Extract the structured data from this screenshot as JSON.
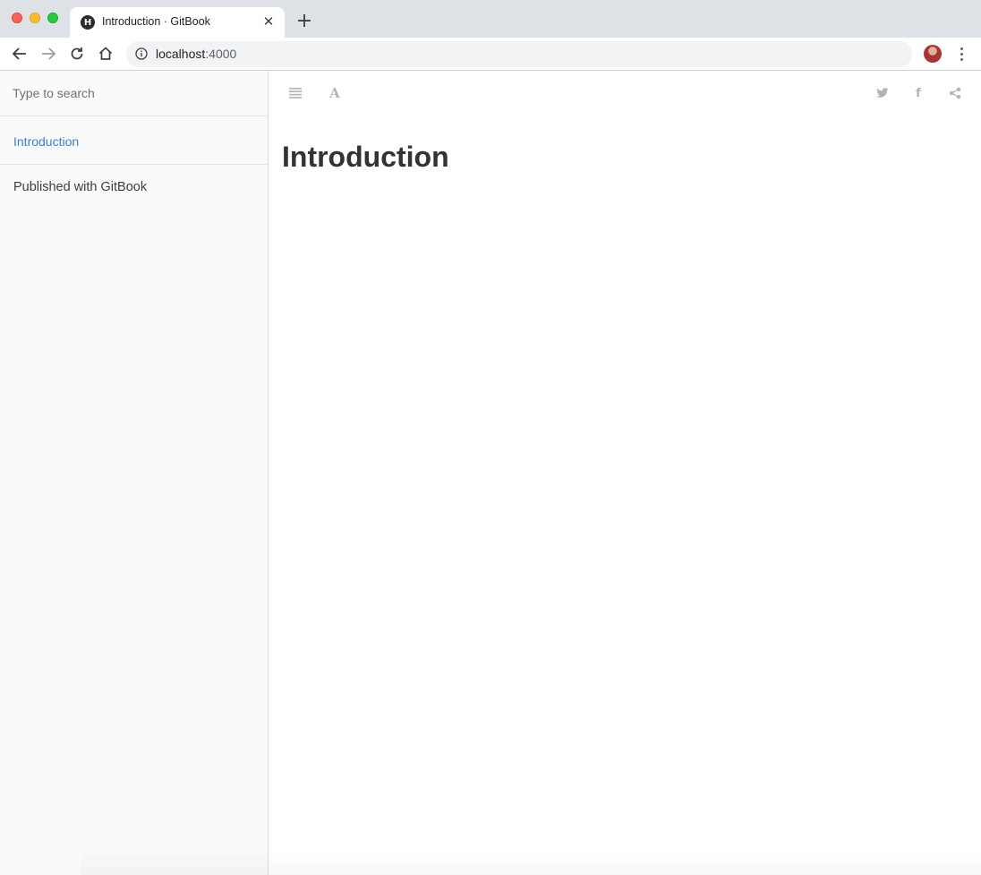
{
  "browser": {
    "tab": {
      "favicon_letter": "H",
      "title": "Introduction · GitBook",
      "close_symbol": "✕"
    },
    "new_tab_symbol": "+",
    "address": {
      "host": "localhost",
      "port": ":4000"
    },
    "icons": {
      "back": "back-arrow-icon",
      "forward": "forward-arrow-icon",
      "reload": "reload-icon",
      "home": "home-icon",
      "info": "info-icon",
      "star": "star-icon",
      "menu": "kebab-menu-icon"
    }
  },
  "sidebar": {
    "search_placeholder": "Type to search",
    "items": [
      {
        "label": "Introduction",
        "active": true,
        "color": "#3b7ddd"
      }
    ],
    "footer_link": "Published with GitBook"
  },
  "header": {
    "left_icons": [
      "toc-toggle-icon",
      "font-settings-icon"
    ],
    "right_icons": [
      "twitter-icon",
      "facebook-icon",
      "share-icon"
    ],
    "font_icon_glyph": "A",
    "facebook_glyph": "f"
  },
  "content": {
    "title": "Introduction"
  }
}
